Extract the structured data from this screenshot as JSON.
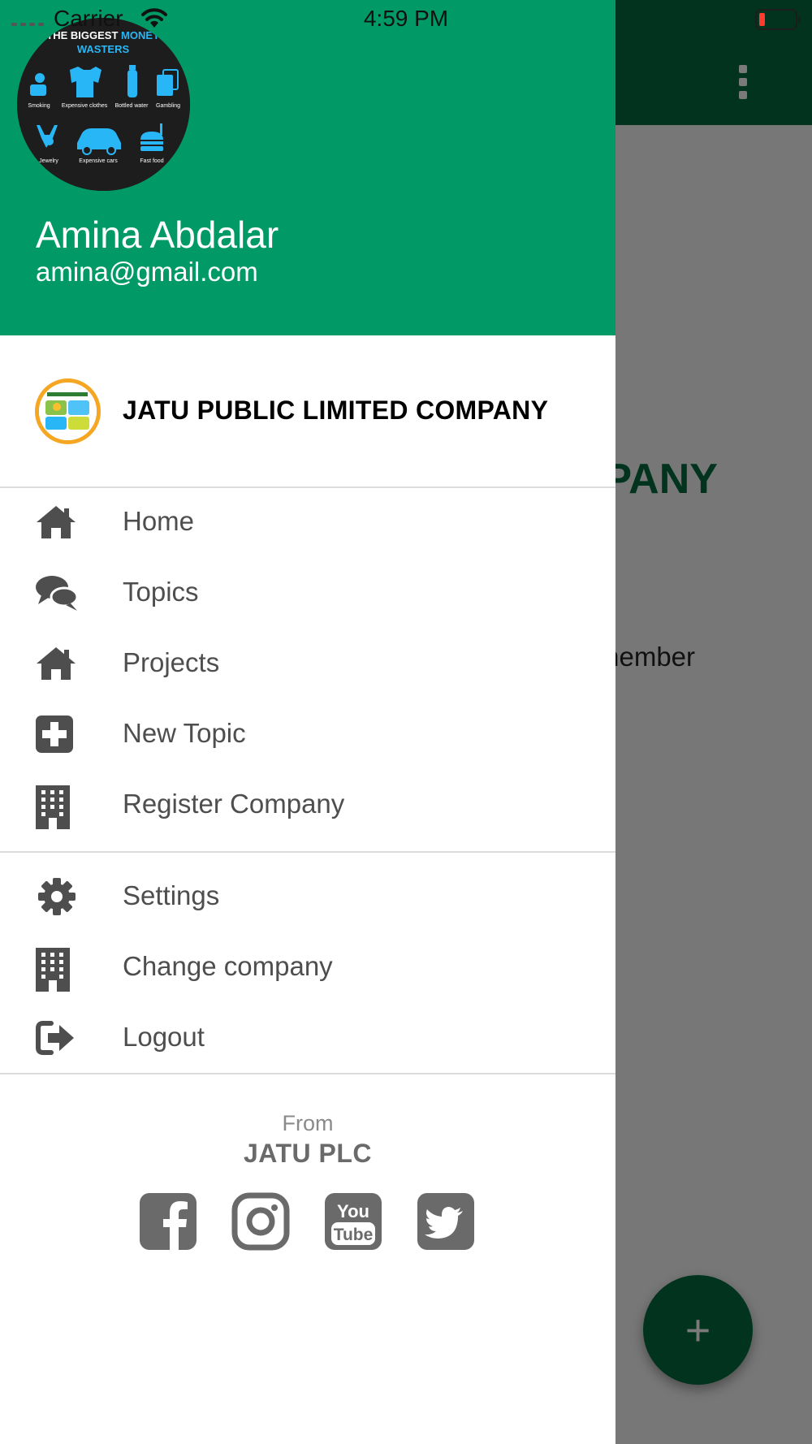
{
  "status_bar": {
    "carrier": "Carrier",
    "time": "4:59 PM"
  },
  "background_screen": {
    "title_fragment": "MPANY",
    "text_fragment": "member",
    "fab_label": "+"
  },
  "drawer": {
    "header": {
      "avatar_texts": {
        "headline_part1": "THE BIGGEST",
        "headline_part2": "MONEY",
        "headline_line2": "WASTERS",
        "labels": [
          "Smoking",
          "Expensive clothes",
          "Bottled water",
          "Gambling",
          "Jewelry",
          "Expensive cars",
          "Fast food"
        ]
      },
      "user_name": "Amina Abdalar",
      "user_email": "amina@gmail.com",
      "background_color": "#019a67"
    },
    "company": {
      "name": "JATU PUBLIC LIMITED COMPANY"
    },
    "menu_primary": [
      {
        "label": "Home",
        "icon": "home-icon"
      },
      {
        "label": "Topics",
        "icon": "chat-icon"
      },
      {
        "label": "Projects",
        "icon": "home-icon"
      },
      {
        "label": "New Topic",
        "icon": "plus-square-icon"
      },
      {
        "label": "Register Company",
        "icon": "building-icon"
      }
    ],
    "menu_secondary": [
      {
        "label": "Settings",
        "icon": "gear-icon"
      },
      {
        "label": "Change company",
        "icon": "building-icon"
      },
      {
        "label": "Logout",
        "icon": "logout-icon"
      }
    ],
    "footer": {
      "from_label": "From",
      "brand": "JATU PLC",
      "social": [
        "facebook-icon",
        "instagram-icon",
        "youtube-icon",
        "twitter-icon"
      ]
    }
  },
  "colors": {
    "accent_green": "#019a67",
    "dark_green": "#01331f",
    "icon_gray": "#4e4e4e",
    "company_logo_ring": "#f5a623"
  }
}
